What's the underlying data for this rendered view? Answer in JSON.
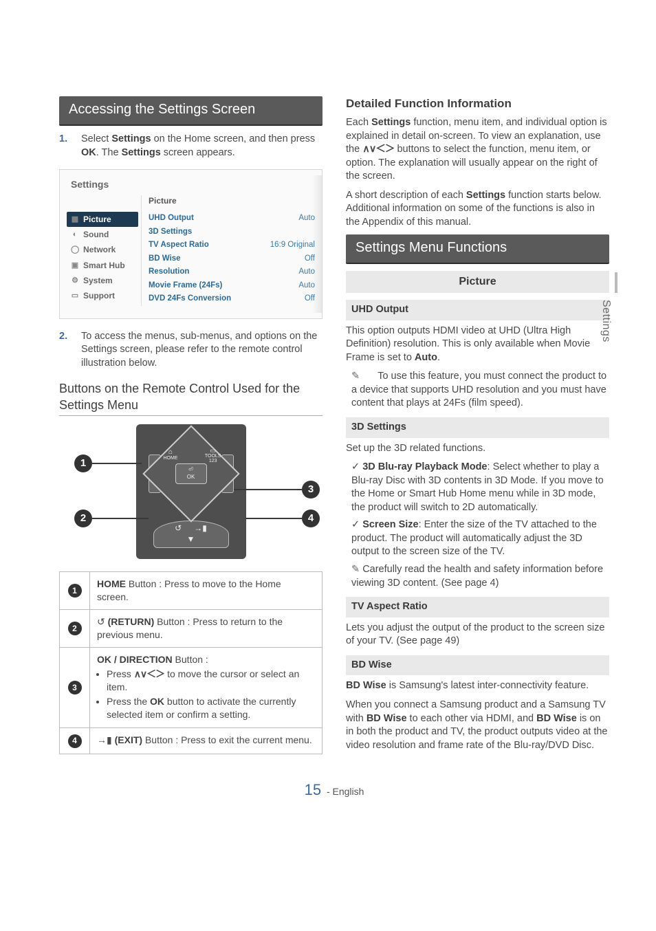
{
  "side_tab": "Settings",
  "left": {
    "bar1": "Accessing the Settings Screen",
    "step1_n": "1.",
    "step1_a": "Select ",
    "step1_b": "Settings",
    "step1_c": " on the Home screen, and then press ",
    "step1_d": "OK",
    "step1_e": ". The ",
    "step1_f": "Settings",
    "step1_g": " screen appears.",
    "shot": {
      "title": "Settings",
      "panel_title": "Picture",
      "sidebar": [
        {
          "icon": "▦",
          "label": "Picture",
          "active": true
        },
        {
          "icon": "◐",
          "label": "Sound"
        },
        {
          "icon": "◯",
          "label": "Network"
        },
        {
          "icon": "▣",
          "label": "Smart Hub"
        },
        {
          "icon": "⚙",
          "label": "System"
        },
        {
          "icon": "▭",
          "label": "Support"
        }
      ],
      "rows": [
        {
          "k": "UHD Output",
          "v": "Auto"
        },
        {
          "k": "3D Settings",
          "v": ""
        },
        {
          "k": "TV Aspect Ratio",
          "v": "16:9 Original"
        },
        {
          "k": "BD Wise",
          "v": "Off"
        },
        {
          "k": "Resolution",
          "v": "Auto"
        },
        {
          "k": "Movie Frame (24Fs)",
          "v": "Auto"
        },
        {
          "k": "DVD 24Fs Conversion",
          "v": "Off"
        }
      ]
    },
    "step2_n": "2.",
    "step2": "To access the menus, sub-menus, and options on the Settings screen, please refer to the remote control illustration below.",
    "subhead": "Buttons on the Remote Control Used for the Settings Menu",
    "remote": {
      "home": "HOME",
      "tools": "TOOLS",
      "tools2": "123",
      "ok_icon": "⏎",
      "ok": "OK"
    },
    "legend": {
      "r1a": "HOME",
      "r1b": " Button : Press to move to the Home screen.",
      "r2a": "↺",
      "r2b": " (RETURN)",
      "r2c": " Button : Press to return to the previous menu.",
      "r3a": "OK / DIRECTION",
      "r3b": " Button :",
      "r3c_a": "Press ",
      "r3c_arrows": "∧∨＜＞",
      "r3c_b": " to move the cursor or select an item.",
      "r3d_a": "Press the ",
      "r3d_b": "OK",
      "r3d_c": " button to activate the currently selected item or confirm a setting.",
      "r4a": "→▮",
      "r4b": " (EXIT)",
      "r4c": " Button : Press to exit the current menu."
    }
  },
  "right": {
    "h1": "Detailed Function Information",
    "p1_a": "Each ",
    "p1_b": "Settings",
    "p1_c": " function, menu item, and individual option is explained in detail on-screen. To view an explanation, use the ",
    "p1_arrows": "∧∨＜＞",
    "p1_d": " buttons to select the function, menu item, or option. The explanation will usually appear on the right of the screen.",
    "p2_a": "A short description of each ",
    "p2_b": "Settings",
    "p2_c": " function starts below. Additional information on some of the functions is also in the Appendix of this manual.",
    "bar2": "Settings Menu Functions",
    "band_picture": "Picture",
    "uhd_h": "UHD Output",
    "uhd_p_a": "This option outputs HDMI video at UHD (Ultra High Definition) resolution. This is only available when Movie Frame is set to ",
    "uhd_p_b": "Auto",
    "uhd_p_c": ".",
    "uhd_note": "To use this feature, you must connect the product to a device that supports UHD resolution and you must have content that plays at 24Fs (film speed).",
    "s3d_h": "3D Settings",
    "s3d_p": "Set up the 3D related functions.",
    "s3d_c1_b": "3D Blu-ray Playback Mode",
    "s3d_c1": ": Select whether to play a Blu-ray Disc with 3D contents in 3D Mode. If you move to the Home or Smart Hub Home menu while in 3D mode, the product will switch to 2D automatically.",
    "s3d_c2_b": "Screen Size",
    "s3d_c2": ": Enter the size of the TV attached to the product. The product will automatically adjust the 3D output to the screen size of the TV.",
    "s3d_note": "Carefully read the health and safety information before viewing 3D content. (See page 4)",
    "tva_h": "TV Aspect Ratio",
    "tva_p": "Lets you adjust the output of the product to the screen size of your TV. (See page 49)",
    "bdw_h": "BD Wise",
    "bdw_p_a": "BD Wise",
    "bdw_p_b": " is Samsung's latest inter-connectivity feature.",
    "bdw_p2_a": "When you connect a Samsung product and a Samsung TV with ",
    "bdw_p2_b": "BD Wise",
    "bdw_p2_c": " to each other via HDMI, and ",
    "bdw_p2_d": "BD Wise",
    "bdw_p2_e": " is on in both the product and TV, the product outputs video at the video resolution and frame rate of the Blu-ray/DVD Disc."
  },
  "footer": {
    "page": "15",
    "lang": " - English"
  }
}
